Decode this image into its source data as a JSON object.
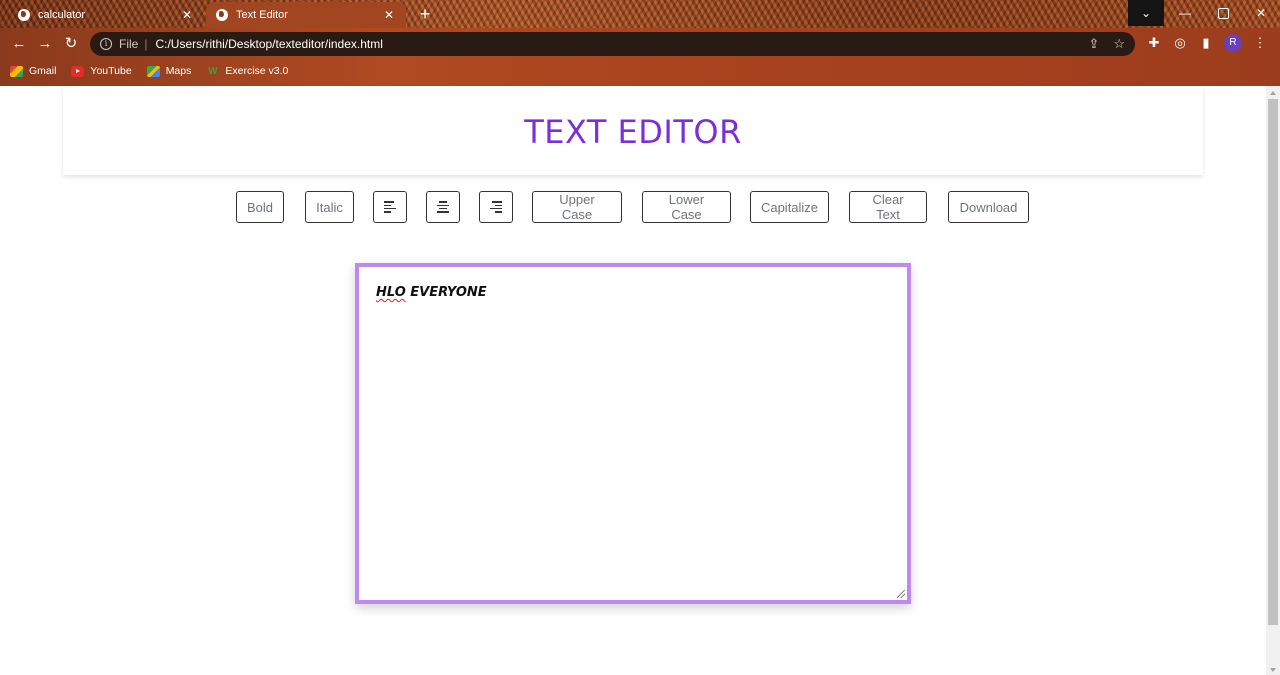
{
  "browser": {
    "tabs": [
      {
        "title": "calculator",
        "active": false
      },
      {
        "title": "Text Editor",
        "active": true
      }
    ],
    "new_tab_icon": "+",
    "address": {
      "prefix": "File",
      "separator": "|",
      "url": "C:/Users/rithi/Desktop/texteditor/index.html"
    },
    "profile_initial": "R",
    "bookmarks": [
      {
        "label": "Gmail",
        "icon": "gmail-icon"
      },
      {
        "label": "YouTube",
        "icon": "youtube-icon"
      },
      {
        "label": "Maps",
        "icon": "maps-icon"
      },
      {
        "label": "Exercise v3.0",
        "icon": "exercise-icon"
      }
    ]
  },
  "page": {
    "title": "TEXT EDITOR",
    "buttons": {
      "bold": "Bold",
      "italic": "Italic",
      "align_left": "align-left-icon",
      "align_center": "align-center-icon",
      "align_right": "align-right-icon",
      "upper_case": "Upper Case",
      "lower_case": "Lower Case",
      "capitalize": "Capitalize",
      "clear_text": "Clear Text",
      "download": "Download"
    },
    "editor": {
      "word1": "HLO",
      "word2": " EVERYONE"
    }
  },
  "colors": {
    "title": "#7b2fd8",
    "editor_border": "#be8af0",
    "button_text": "#6c757d"
  }
}
